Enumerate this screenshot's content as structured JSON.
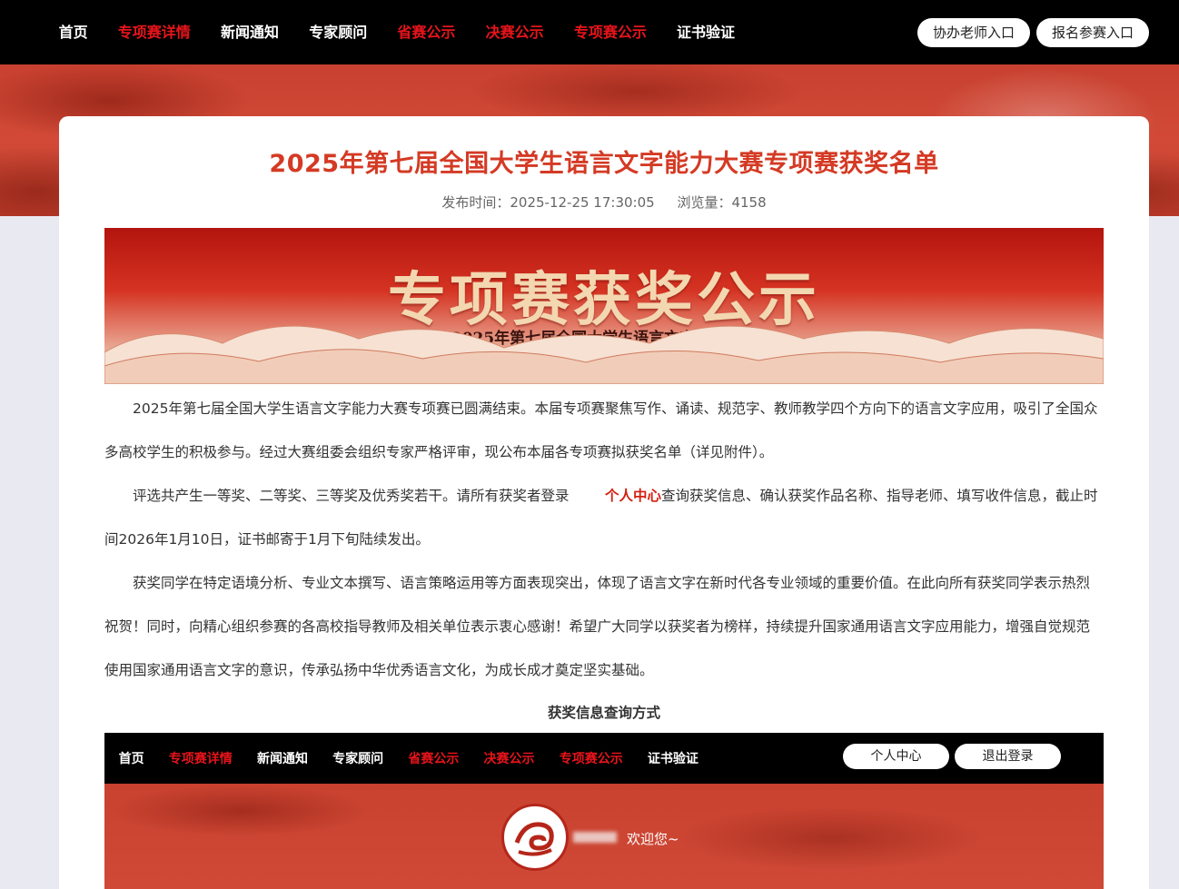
{
  "nav": {
    "items": [
      {
        "label": "首页",
        "active": false
      },
      {
        "label": "专项赛详情",
        "active": true
      },
      {
        "label": "新闻通知",
        "active": false
      },
      {
        "label": "专家顾问",
        "active": false
      },
      {
        "label": "省赛公示",
        "active": true
      },
      {
        "label": "决赛公示",
        "active": true
      },
      {
        "label": "专项赛公示",
        "active": true
      },
      {
        "label": "证书验证",
        "active": false
      }
    ],
    "teacher_button": "协办老师入口",
    "register_button": "报名参赛入口"
  },
  "article": {
    "title": "2025年第七届全国大学生语言文字能力大赛专项赛获奖名单",
    "publish_time_label": "发布时间：2025-12-25 17:30:05",
    "views_label": "浏览量：4158",
    "banner_title": "专项赛获奖公示",
    "banner_subtitle": "2025年第七届全国大学生语言文字能力大赛",
    "para1": "2025年第七届全国大学生语言文字能力大赛专项赛已圆满结束。本届专项赛聚焦写作、诵读、规范字、教师教学四个方向下的语言文字应用，吸引了全国众多高校学生的积极参与。经过大赛组委会组织专家严格评审，现公布本届各专项赛拟获奖名单（详见附件）。",
    "para2_before": "评选共产生一等奖、二等奖、三等奖及优秀奖若干。请所有获奖者登录",
    "para2_link": "个人中心",
    "para2_after": "查询获奖信息、确认获奖作品名称、指导老师、填写收件信息，截止时间2026年1月10日，证书邮寄于1月下旬陆续发出。",
    "para3": "获奖同学在特定语境分析、专业文本撰写、语言策略运用等方面表现突出，体现了语言文字在新时代各专业领域的重要价值。在此向所有获奖同学表示热烈祝贺！同时，向精心组织参赛的各高校指导教师及相关单位表示衷心感谢！希望广大同学以获奖者为榜样，持续提升国家通用语言文字应用能力，增强自觉规范使用国家通用语言文字的意识，传承弘扬中华优秀语言文化，为成长成才奠定坚实基础。",
    "section_title": "获奖信息查询方式"
  },
  "screenshot": {
    "nav": [
      "首页",
      "专项赛详情",
      "新闻通知",
      "专家顾问",
      "省赛公示",
      "决赛公示",
      "专项赛公示",
      "证书验证"
    ],
    "personal_center_button": "个人中心",
    "logout_button": "退出登录",
    "welcome": "欢迎您~"
  },
  "colors": {
    "accent": "#d43a24",
    "nav_bg": "#000000",
    "nav_active": "#e8141b"
  }
}
